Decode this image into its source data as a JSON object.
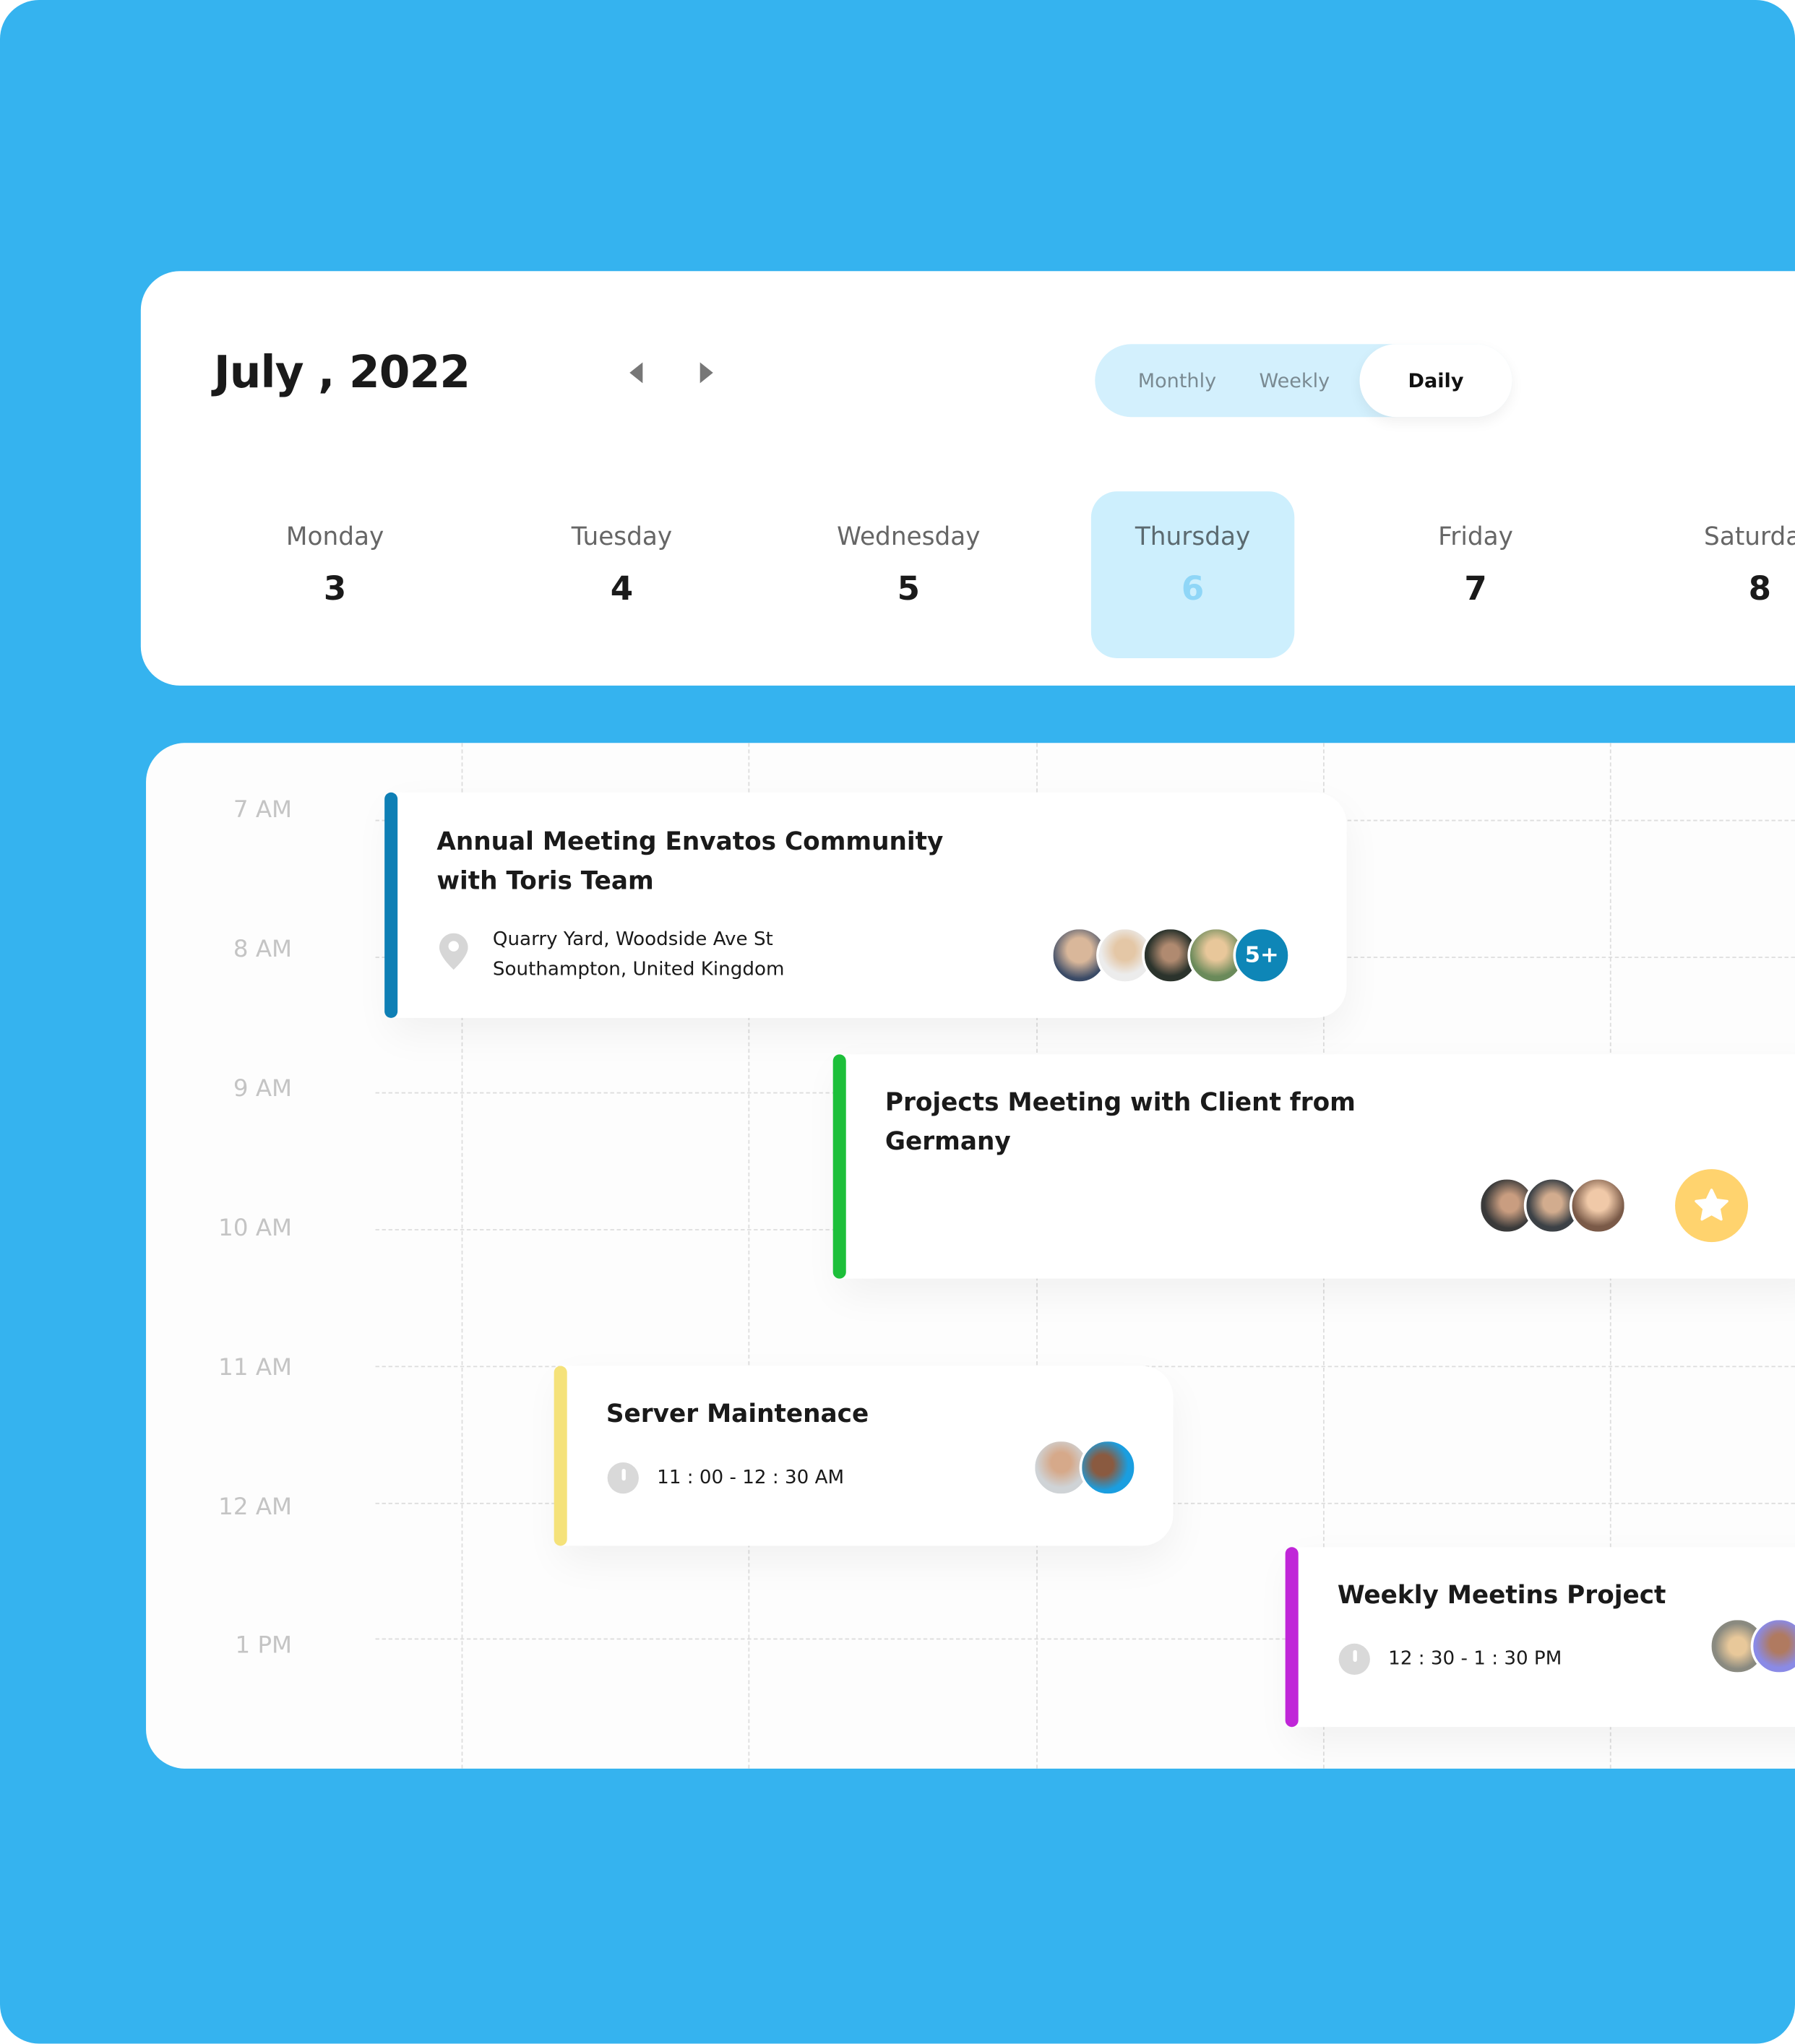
{
  "header": {
    "title": "July , 2022",
    "prev_icon": "caret-left-icon",
    "next_icon": "caret-right-icon"
  },
  "view_toggle": {
    "options": [
      "Monthly",
      "Weekly",
      "Daily"
    ],
    "selected": "Daily"
  },
  "days": [
    {
      "name": "Monday",
      "num": "3"
    },
    {
      "name": "Tuesday",
      "num": "4"
    },
    {
      "name": "Wednesday",
      "num": "5"
    },
    {
      "name": "Thursday",
      "num": "6",
      "selected": true
    },
    {
      "name": "Friday",
      "num": "7"
    },
    {
      "name": "Saturday",
      "num": "8"
    }
  ],
  "times": [
    "7 AM",
    "8 AM",
    "9 AM",
    "10 AM",
    "11 AM",
    "12 AM",
    "1 PM"
  ],
  "events": [
    {
      "title_l1": "Annual Meeting Envatos Community",
      "title_l2": "with Toris Team",
      "loc_l1": "Quarry Yard, Woodside Ave St",
      "loc_l2": "Southampton, United Kingdom",
      "more": "5+",
      "color": "#0E7FB5"
    },
    {
      "title_l1": "Projects Meeting with Client from",
      "title_l2": "Germany",
      "color": "#1DBF3A",
      "icon": "star-icon"
    },
    {
      "title": "Server Maintenace",
      "time": "11 : 00 - 12 : 30 AM",
      "color": "#F5E27A"
    },
    {
      "title": "Weekly Meetins Project",
      "time": "12 : 30 - 1 : 30 PM",
      "color": "#C026D8"
    }
  ],
  "colors": {
    "background": "#35B3EF",
    "selected_day": "#CDEFFD",
    "toggle": "#D3F0FD",
    "star": "#FFD36E",
    "more_badge": "#0E86B7"
  }
}
